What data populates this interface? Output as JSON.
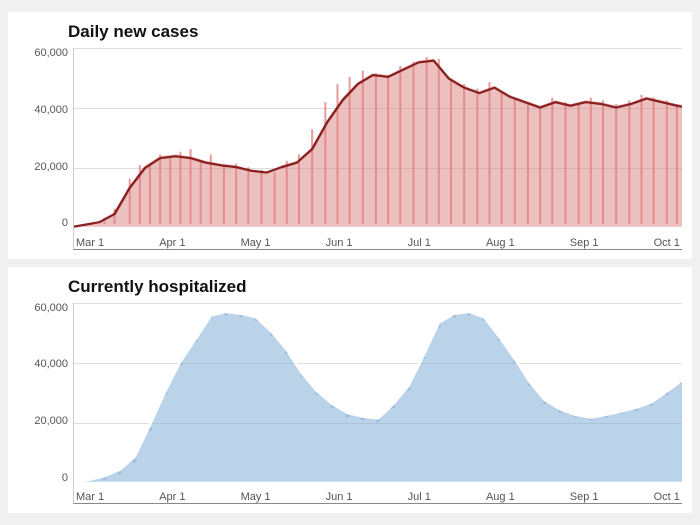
{
  "charts": [
    {
      "title": "Daily new cases",
      "type": "cases",
      "y_labels": [
        "60,000",
        "40,000",
        "20,000",
        "0"
      ],
      "x_labels": [
        "Mar 1",
        "Apr 1",
        "May 1",
        "Jun 1",
        "Jul 1",
        "Aug 1",
        "Sep 1",
        "Oct 1"
      ],
      "fill_color": "rgba(220, 130, 130, 0.55)",
      "stroke_color": "#8b0000",
      "bar_color": "rgba(220, 110, 110, 0.7)"
    },
    {
      "title": "Currently hospitalized",
      "type": "hospitalized",
      "y_labels": [
        "60,000",
        "40,000",
        "20,000",
        "0"
      ],
      "x_labels": [
        "Mar 1",
        "Apr 1",
        "May 1",
        "Jun 1",
        "Jul 1",
        "Aug 1",
        "Sep 1",
        "Oct 1"
      ],
      "fill_color": "rgba(130, 170, 210, 0.6)",
      "stroke_color": "#fff",
      "bar_color": "rgba(150, 185, 220, 0.6)"
    }
  ]
}
